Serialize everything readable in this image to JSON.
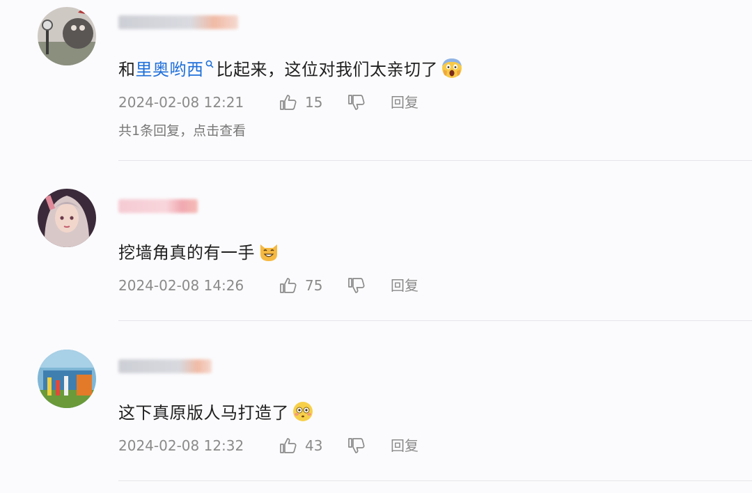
{
  "comments": [
    {
      "content_prefix": "和",
      "mention": "里奥哟西",
      "content_suffix": "比起来，这位对我们太亲切了",
      "emoji": "scream-emoji",
      "timestamp": "2024-02-08 12:21",
      "likes": "15",
      "reply_label": "回复",
      "replies_link": "共1条回复，点击查看"
    },
    {
      "content": "挖墙角真的有一手",
      "emoji": "cat-grin-emoji",
      "timestamp": "2024-02-08 14:26",
      "likes": "75",
      "reply_label": "回复"
    },
    {
      "content": "这下真原版人马打造了",
      "emoji": "flushed-emoji",
      "timestamp": "2024-02-08 12:32",
      "likes": "43",
      "reply_label": "回复"
    }
  ],
  "colors": {
    "mention": "#1e6fd9",
    "meta_text": "#8a8a8a",
    "divider": "#e6e6ea"
  }
}
